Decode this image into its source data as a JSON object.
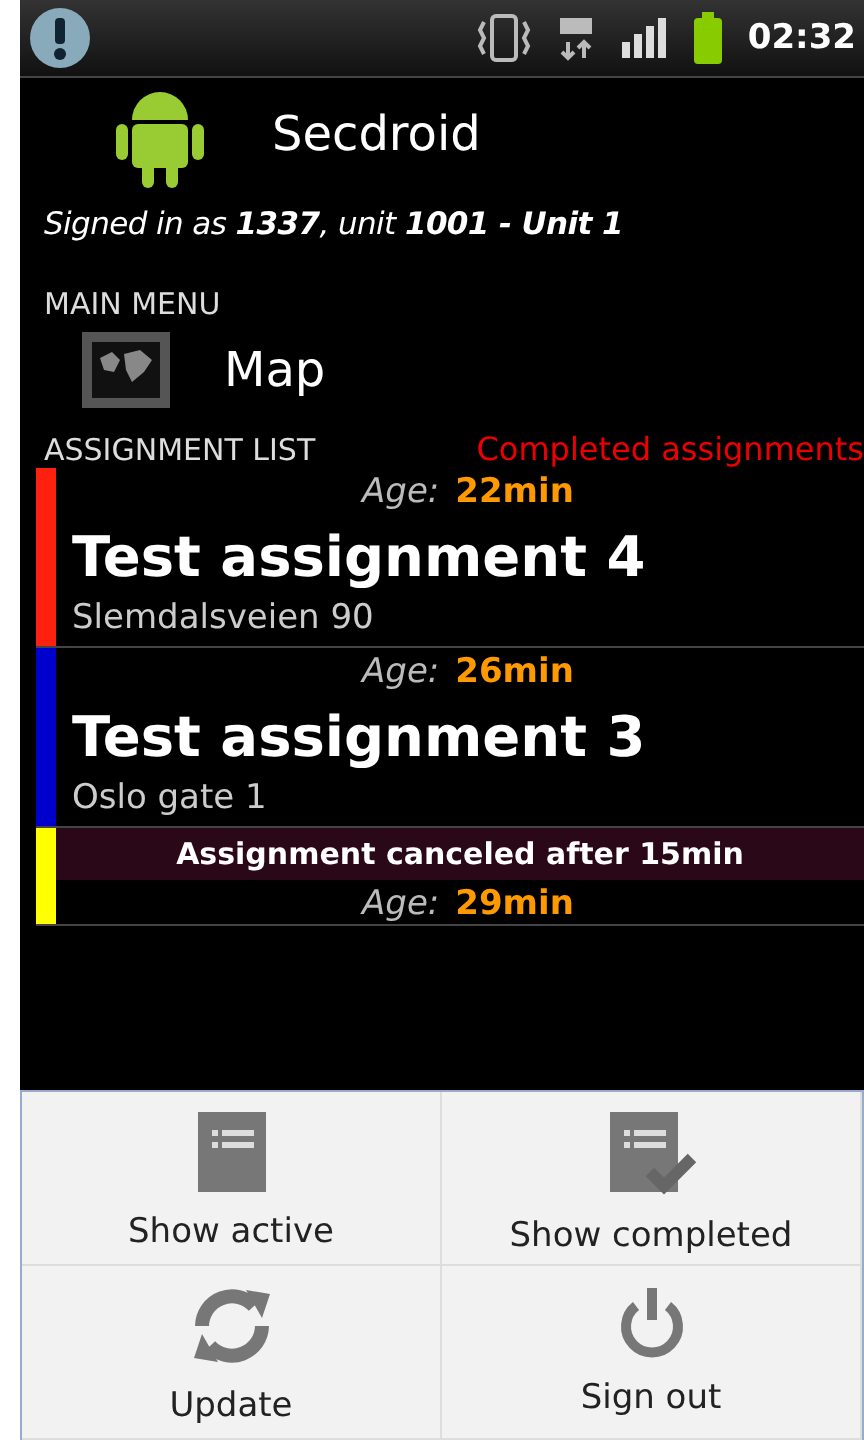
{
  "status_bar": {
    "time": "02:32"
  },
  "header": {
    "title": "Secdroid",
    "signed_in": "Signed in as **1337**, unit **1001 - Unit 1**"
  },
  "main_menu": {
    "heading": "MAIN MENU",
    "items": [
      {
        "label": "Map"
      }
    ]
  },
  "assignment_list": {
    "heading": "ASSIGNMENT LIST",
    "link": "Completed assignments",
    "items": [
      {
        "color": "#ff2010",
        "age_label": "Age:",
        "age": "22min",
        "title": "Test assignment 4",
        "address": "Slemdalsveien 90"
      },
      {
        "color": "#0000cc",
        "age_label": "Age:",
        "age": "26min",
        "title": "Test assignment 3",
        "address": "Oslo gate 1"
      },
      {
        "color": "#ffff00",
        "notice": "Assignment canceled after 15min",
        "age_label": "Age:",
        "age": "29min"
      }
    ]
  },
  "options_menu": [
    {
      "kind": "list",
      "label": "Show active"
    },
    {
      "kind": "checklist",
      "label": "Show completed"
    },
    {
      "kind": "refresh",
      "label": "Update"
    },
    {
      "kind": "power",
      "label": "Sign out"
    }
  ]
}
